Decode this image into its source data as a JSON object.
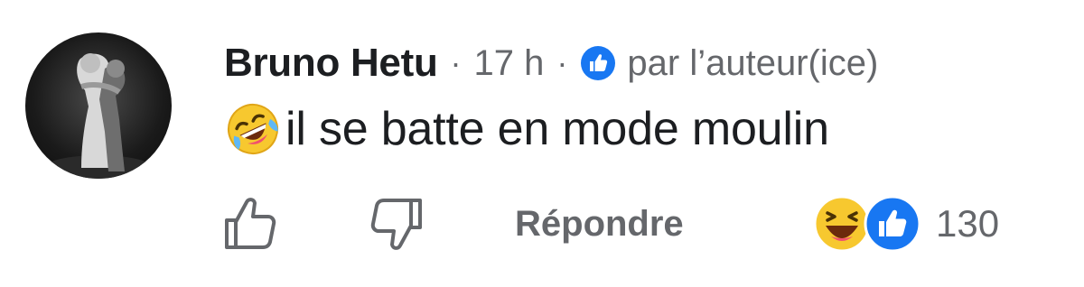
{
  "comment": {
    "author": "Bruno Hetu",
    "separator": "·",
    "time": "17 h",
    "author_badge_text": "par l’auteur(ice)",
    "emoji": "rolling-on-floor-laughing",
    "text": "il se batte en mode moulin"
  },
  "actions": {
    "reply_label": "Répondre",
    "reaction_count": "130",
    "reactions": [
      "haha",
      "like"
    ]
  },
  "colors": {
    "text_primary": "#1c1e21",
    "text_secondary": "#65676b",
    "like_blue": "#1877f2",
    "emoji_yellow": "#f7c82f"
  }
}
